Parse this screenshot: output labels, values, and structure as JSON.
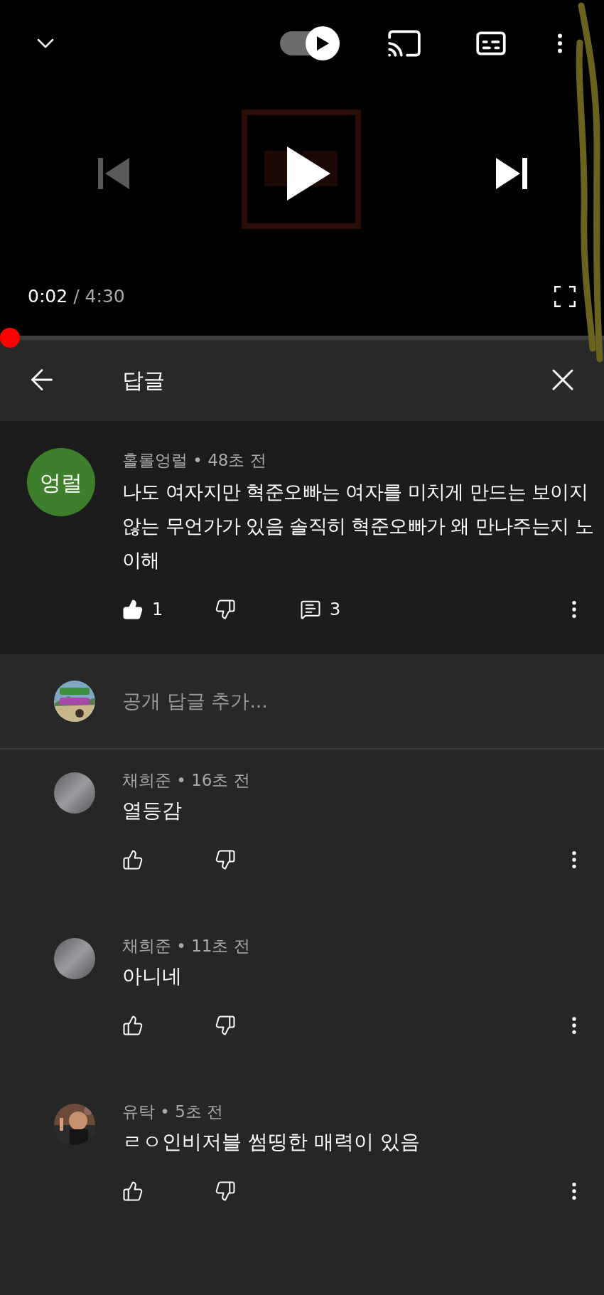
{
  "player": {
    "autoplay_on": true,
    "elapsed": "0:02",
    "separator": "/",
    "duration": "4:30",
    "progress": {
      "level": 0.008
    }
  },
  "panel": {
    "title": "답글"
  },
  "parent_comment": {
    "avatar_text": "엉럴",
    "meta": "홀롤엉럴 • 48초 전",
    "text": "나도 여자지만 혁준오빠는 여자를 미치게 만드는 보이지 않는 무언가가 있음 솔직히 혁준오빠가 왜 만나주는지 노이해",
    "liked": true,
    "likes": "1",
    "reply_count": "3"
  },
  "reply_box": {
    "placeholder": "공개 답글 추가..."
  },
  "replies": [
    {
      "kind": "plain",
      "meta": "채희준 • 16초 전",
      "text": "열등감",
      "liked": false
    },
    {
      "kind": "plain",
      "meta": "채희준 • 11초 전",
      "text": "아니네",
      "liked": false
    },
    {
      "kind": "picture",
      "meta": "유탁 • 5초 전",
      "text": "ㄹㅇ인비저블 썸띵한 매력이 있음",
      "liked": false
    }
  ]
}
